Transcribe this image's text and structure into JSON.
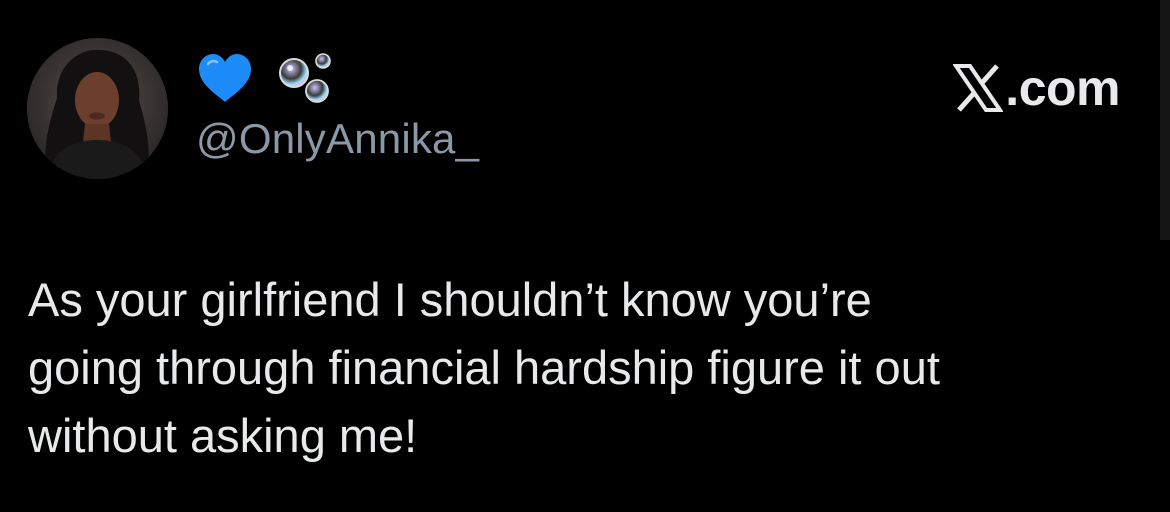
{
  "author": {
    "handle": "@OnlyAnnika_",
    "display_emoji": [
      "blue-heart-icon",
      "soap-bubbles-icon"
    ]
  },
  "brand": {
    "logo": "x-logo-icon",
    "suffix": ".com"
  },
  "tweet": {
    "text": "As your girlfriend I shouldn’t know you’re\ngoing through financial hardship figure it out\nwithout asking me!"
  },
  "colors": {
    "background": "#000000",
    "text": "#e7e9ea",
    "handle": "#8b98a5",
    "heart": "#1d8cf8"
  }
}
